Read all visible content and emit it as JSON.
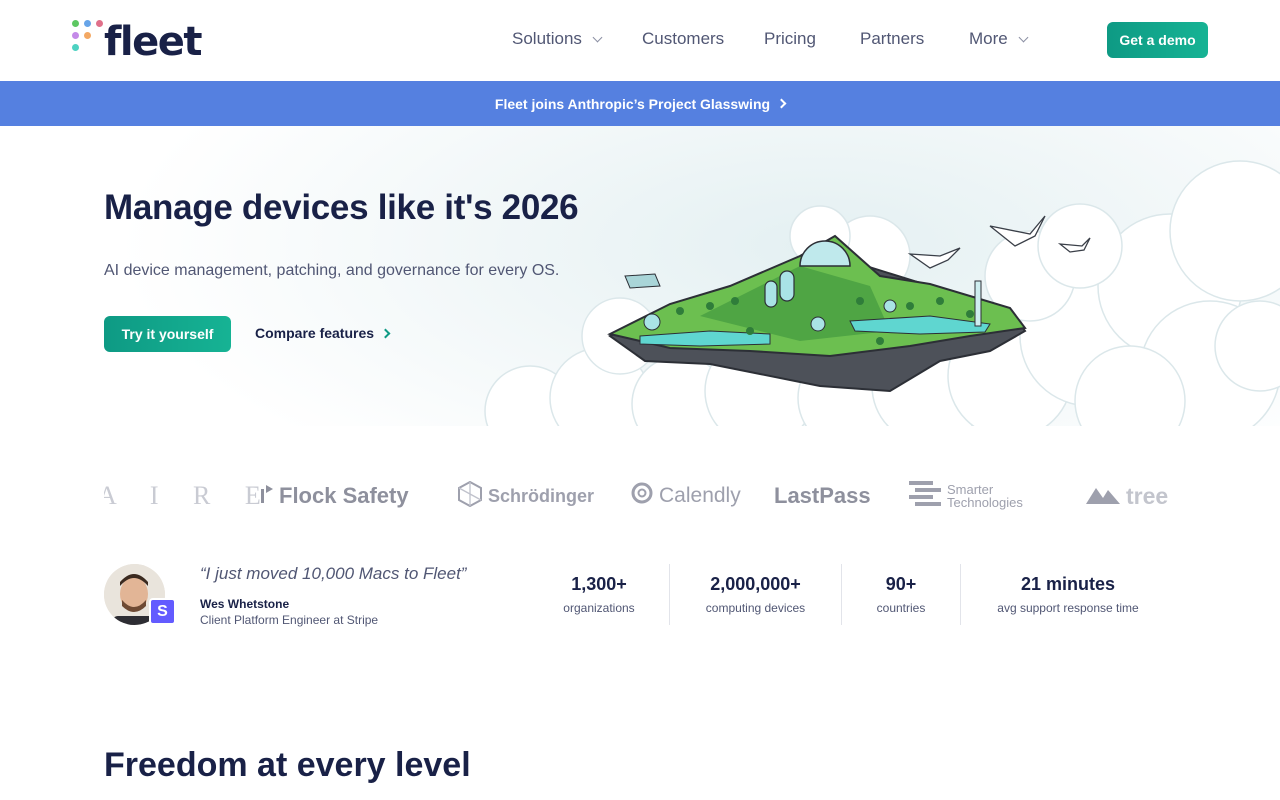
{
  "header": {
    "logo_text": "fleet",
    "nav": [
      {
        "label": "Solutions",
        "has_dropdown": true
      },
      {
        "label": "Customers",
        "has_dropdown": false
      },
      {
        "label": "Pricing",
        "has_dropdown": false
      },
      {
        "label": "Partners",
        "has_dropdown": false
      },
      {
        "label": "More",
        "has_dropdown": true
      }
    ],
    "cta_label": "Get a demo"
  },
  "banner": {
    "text": "Fleet joins Anthropic’s Project Glasswing",
    "icon": "chevron-right-icon"
  },
  "hero": {
    "title": "Manage devices like it's 2026",
    "subtitle": "AI device management, patching, and governance for every OS.",
    "primary_button": "Try it yourself",
    "secondary_link": "Compare features",
    "illustration": "floating-island-city-in-clouds"
  },
  "customers": [
    {
      "name": "A I R E",
      "icon": null
    },
    {
      "name": "Flock Safety",
      "icon": "flock-icon"
    },
    {
      "name": "Schrödinger",
      "icon": "schrodinger-cube-icon"
    },
    {
      "name": "Calendly",
      "icon": "calendly-icon"
    },
    {
      "name": "LastPass",
      "icon": null
    },
    {
      "name": "Smarter",
      "name2": "Technologies",
      "icon": "smarter-technologies-icon"
    },
    {
      "name": "tree",
      "icon": "mountain-icon"
    }
  ],
  "testimonial": {
    "quote": "“I just moved 10,000 Macs to Fleet”",
    "name": "Wes Whetstone",
    "role": "Client Platform Engineer at Stripe",
    "company_badge": "S"
  },
  "stats": [
    {
      "value": "1,300+",
      "label": "organizations"
    },
    {
      "value": "2,000,000+",
      "label": "computing devices"
    },
    {
      "value": "90+",
      "label": "countries"
    },
    {
      "value": "21 minutes",
      "label": "avg support response time"
    }
  ],
  "next_section": {
    "title": "Freedom at every level"
  },
  "colors": {
    "brand_navy": "#192147",
    "accent_green": "#0e9a84",
    "banner_blue": "#5580e0",
    "stripe_purple": "#635bff",
    "logo_dots": [
      "#5dc762",
      "#67a4e8",
      "#e0708a",
      "#c48ae8",
      "#f3a863",
      "#4dd2c1"
    ]
  }
}
